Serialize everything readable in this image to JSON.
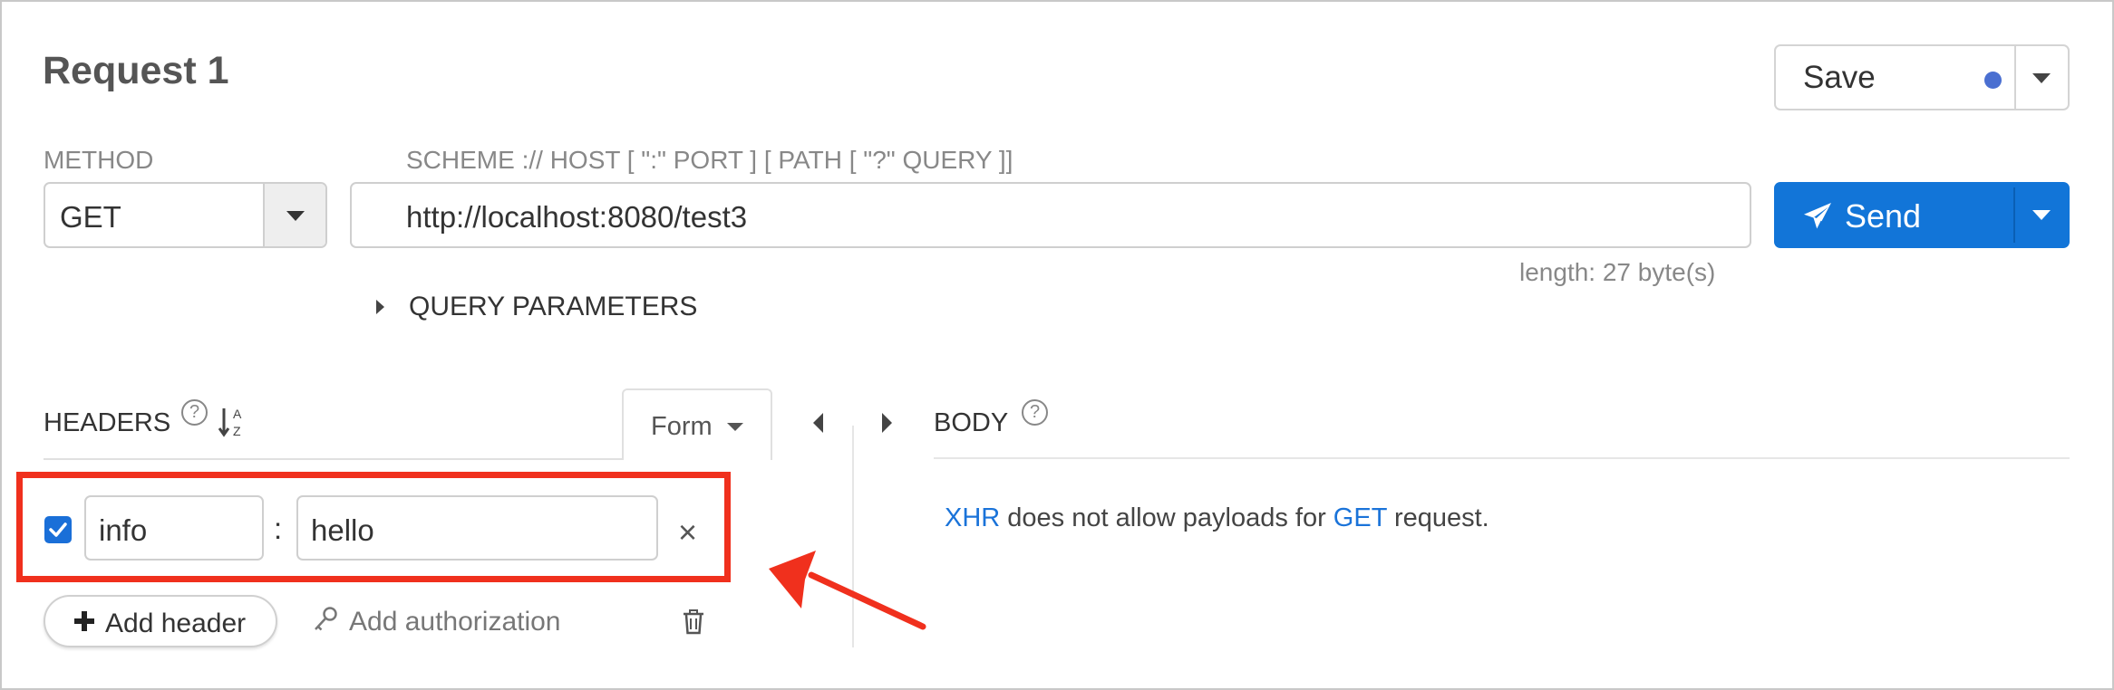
{
  "title": "Request 1",
  "save": {
    "label": "Save",
    "dot_color": "#4a6fd1"
  },
  "method": {
    "label": "METHOD",
    "value": "GET"
  },
  "url": {
    "label": "SCHEME :// HOST [ \":\" PORT ] [ PATH [ \"?\" QUERY ]]",
    "value": "http://localhost:8080/test3",
    "length_text": "length: 27 byte(s)"
  },
  "send": {
    "label": "Send",
    "color": "#1275d8"
  },
  "query_parameters": {
    "label": "QUERY PARAMETERS"
  },
  "headers": {
    "label": "HEADERS",
    "help_icon": "?",
    "view_mode": "Form",
    "rows": [
      {
        "enabled": true,
        "name": "info",
        "separator": ":",
        "value": "hello",
        "remove_icon": "×"
      }
    ],
    "add_header_label": "Add header",
    "add_authorization_label": "Add authorization"
  },
  "body": {
    "label": "BODY",
    "help_icon": "?",
    "message": {
      "link1": "XHR",
      "part1": " does not allow payloads for ",
      "link2": "GET",
      "part2": " request."
    }
  },
  "annotation": {
    "highlight_color": "#f0301d"
  }
}
